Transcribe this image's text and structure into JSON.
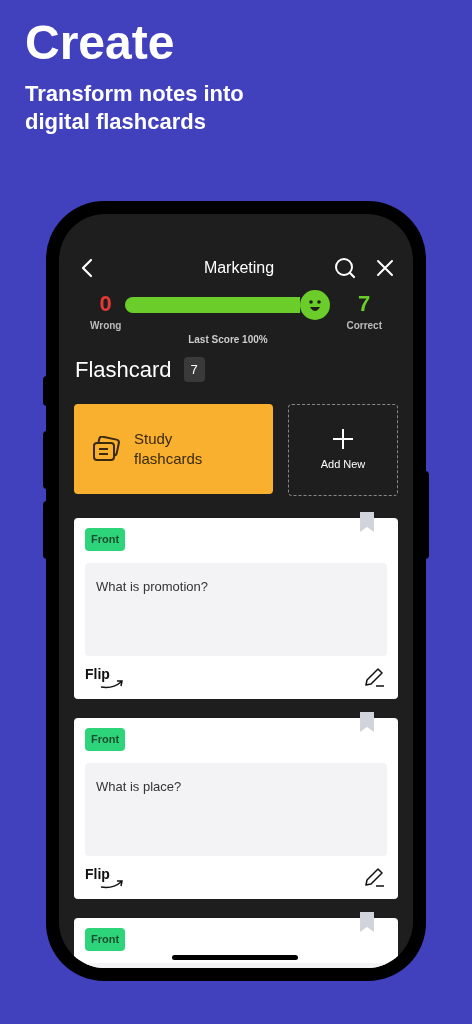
{
  "headline": "Create",
  "subtitle": "Transform notes into digital flashcards",
  "header": {
    "title": "Marketing"
  },
  "score": {
    "wrong_count": "0",
    "wrong_label": "Wrong",
    "correct_count": "7",
    "correct_label": "Correct",
    "level": 1.0,
    "last_score": "Last Score 100%"
  },
  "section": {
    "title": "Flashcard",
    "count": "7"
  },
  "actions": [
    {
      "kind": "study",
      "label": "Study flashcards"
    },
    {
      "kind": "add",
      "label": "Add New"
    }
  ],
  "cards": [
    {
      "side": "Front",
      "question": "What is promotion?",
      "flip_label": "Flip",
      "bookmarked": false
    },
    {
      "side": "Front",
      "question": "What is place?",
      "flip_label": "Flip",
      "bookmarked": false
    },
    {
      "side": "Front",
      "bookmarked": false
    }
  ]
}
